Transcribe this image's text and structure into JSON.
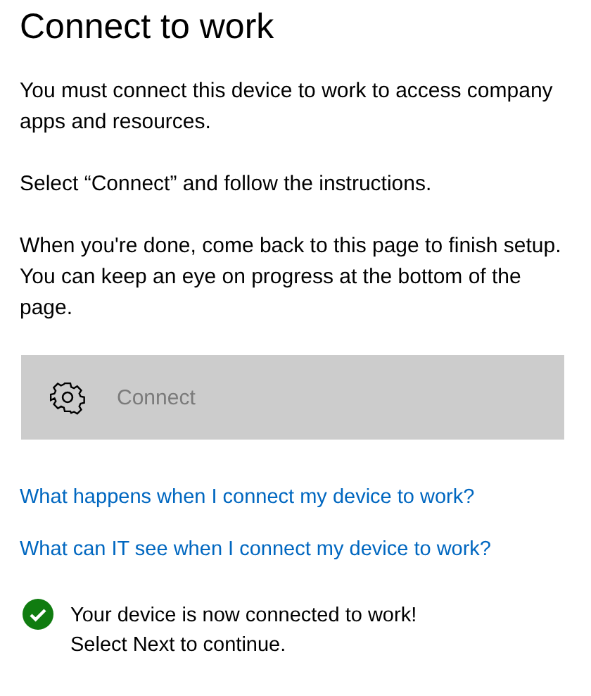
{
  "title": "Connect to work",
  "paragraphs": [
    "You must connect this device to work to access company apps and resources.",
    "Select “Connect” and follow the instructions.",
    "When you're done, come back to this page to finish setup. You can keep an eye on progress at the bottom of the page."
  ],
  "connect_button": {
    "label": "Connect",
    "disabled": true
  },
  "links": [
    "What happens when I connect my device to work?",
    "What can IT see when I connect my device to work?"
  ],
  "status": {
    "connected": true,
    "lines": [
      "Your device is now connected to work!",
      "Select Next to continue."
    ]
  }
}
